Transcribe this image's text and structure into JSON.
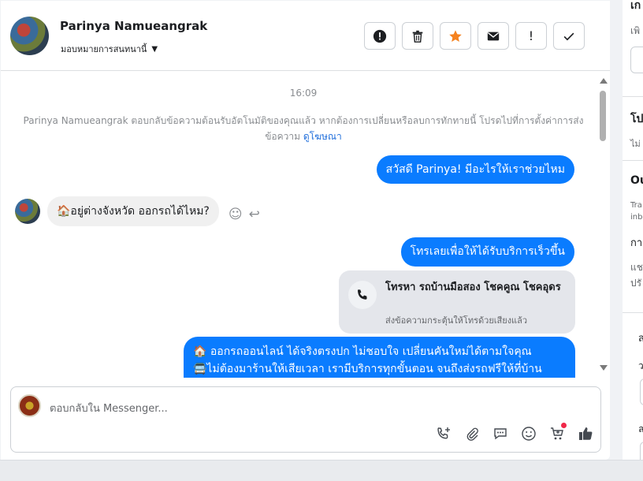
{
  "header": {
    "contact_name": "Parinya Namueangrak",
    "assign_label": "มอบหมายการสนทนานี้",
    "actions": [
      "report-icon",
      "trash-icon",
      "star-icon",
      "mail-icon",
      "exclamation",
      "check"
    ],
    "exclaim_label": "!"
  },
  "messages": {
    "time": "16:09",
    "system_note": "Parinya Namueangrak ตอบกลับข้อความต้อนรับอัตโนมัติของคุณแล้ว หากต้องการเปลี่ยนหรือลบการทักทายนี้ โปรดไปที่การตั้งค่าการส่งข้อความ",
    "system_link": "ดูโฆษณา",
    "out_1": "สวัสดี Parinya! มีอะไรให้เราช่วยไหม",
    "in_1": "🏠อยู่ต่างจังหวัด ออกรถได้ไหม?",
    "out_2": "โทรเลยเพื่อให้ได้รับบริการเร็วขึ้น",
    "call_title": "โทรหา รถบ้านมือสอง โชคคูณ โชคอุดร",
    "call_sub": "ส่งข้อความกระตุ้นให้โทรด้วยเสียงแล้ว",
    "out_3_line1": "🏠 ออกรถออนไลน์ ได้จริงตรงปก ไม่ชอบใจ เปลี่ยนคันใหม่ได้ตามใจคุณ",
    "out_3_line2": "🚍ไม่ต้องมาร้านให้เสียเวลา เรามีบริการทุกขั้นตอน จนถึงส่งรถฟรีให้ที่บ้าน"
  },
  "composer": {
    "placeholder": "ตอบกลับใน Messenger...",
    "tools": [
      "add-call-icon",
      "attach-icon",
      "chat-icon",
      "emoji-icon",
      "cart-icon",
      "like-icon"
    ]
  },
  "right_panel": {
    "t1": "เก",
    "t2": "เพิ",
    "t3": "โป",
    "t4": "ไม่",
    "t5": "Ou",
    "t6": "Tra",
    "t7": "inb",
    "t8": "กา",
    "t9": "แช",
    "t10": "ปรั",
    "t11": "ส",
    "t12": "ว",
    "t13": "ล"
  },
  "colors": {
    "accent": "#0a7cff",
    "star": "#f5821f",
    "like": "#444950"
  }
}
